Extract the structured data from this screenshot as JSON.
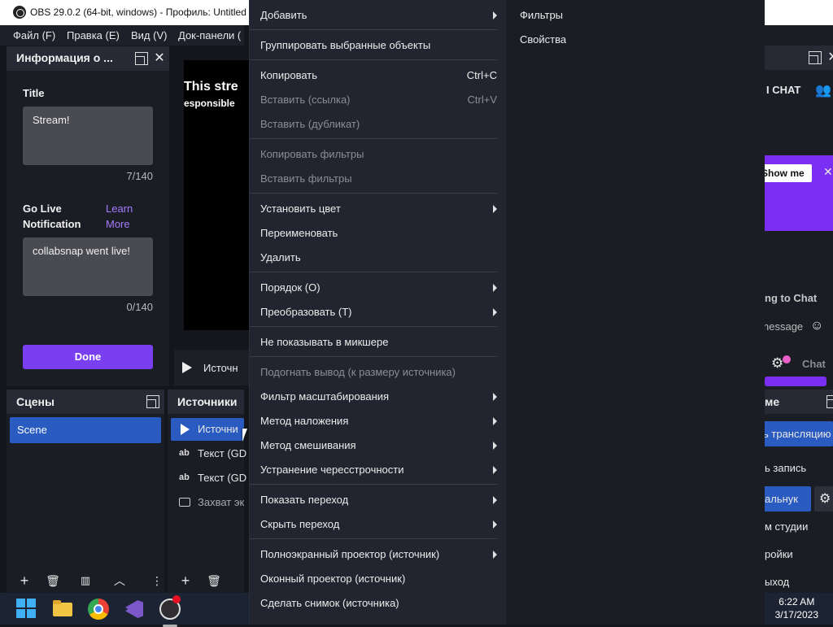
{
  "window": {
    "title": "OBS 29.0.2 (64-bit, windows) - Профиль: Untitled",
    "minimize_glyph": "—",
    "maximize_glyph": "☐",
    "close_glyph": "✕"
  },
  "menubar": [
    "Файл (F)",
    "Правка (E)",
    "Вид (V)",
    "Док-панели ("
  ],
  "info_dock": {
    "title": "Информация о ...",
    "title_label": "Title",
    "title_value": "Stream!",
    "title_count": "7/140",
    "notification_label_1": "Go Live",
    "notification_label_2": "Notification",
    "learn_more_1": "Learn",
    "learn_more_2": "More",
    "notification_value": "collabsnap went live!",
    "notification_count": "0/140",
    "done_label": "Done"
  },
  "preview": {
    "line1": "This stre",
    "line2": "esponsible"
  },
  "source_toolbar": {
    "name": "Источн"
  },
  "scenes": {
    "title": "Сцены",
    "items": [
      "Scene"
    ]
  },
  "sources": {
    "title": "Источники",
    "items": [
      {
        "icon": "play-icon",
        "name": "Источни"
      },
      {
        "icon": "text-icon",
        "name": "Текст (GD"
      },
      {
        "icon": "text-icon",
        "name": "Текст (GD"
      },
      {
        "icon": "monitor-icon",
        "name": "Захват эк"
      }
    ],
    "text_icon_glyph": "ab"
  },
  "context_menu": {
    "items": [
      {
        "label": "Добавить",
        "submenu": true,
        "disabled": false
      },
      {
        "sep": true
      },
      {
        "label": "Группировать выбранные объекты",
        "disabled": false
      },
      {
        "sep": true
      },
      {
        "label": "Копировать",
        "shortcut": "Ctrl+C",
        "disabled": false
      },
      {
        "label": "Вставить (ссылка)",
        "shortcut": "Ctrl+V",
        "disabled": true
      },
      {
        "label": "Вставить (дубликат)",
        "disabled": true
      },
      {
        "sep": true
      },
      {
        "label": "Копировать фильтры",
        "disabled": true
      },
      {
        "label": "Вставить фильтры",
        "disabled": true
      },
      {
        "sep": true
      },
      {
        "label": "Установить цвет",
        "submenu": true,
        "disabled": false
      },
      {
        "label": "Переименовать",
        "disabled": false
      },
      {
        "label": "Удалить",
        "disabled": false
      },
      {
        "sep": true
      },
      {
        "label": "Порядок (O)",
        "submenu": true,
        "disabled": false
      },
      {
        "label": "Преобразовать (T)",
        "submenu": true,
        "disabled": false
      },
      {
        "sep": true
      },
      {
        "label": "Не показывать в микшере",
        "disabled": false
      },
      {
        "sep": true
      },
      {
        "label": "Подогнать вывод (к размеру источника)",
        "disabled": true
      },
      {
        "label": "Фильтр масштабирования",
        "submenu": true,
        "disabled": false
      },
      {
        "label": "Метод наложения",
        "submenu": true,
        "disabled": false
      },
      {
        "label": "Метод смешивания",
        "submenu": true,
        "disabled": false
      },
      {
        "label": "Устранение чересстрочности",
        "submenu": true,
        "disabled": false
      },
      {
        "sep": true
      },
      {
        "label": "Показать переход",
        "submenu": true,
        "disabled": false
      },
      {
        "label": "Скрыть переход",
        "submenu": true,
        "disabled": false
      },
      {
        "sep": true
      },
      {
        "label": "Полноэкранный проектор (источник)",
        "submenu": true,
        "disabled": false
      },
      {
        "label": "Оконный проектор (источник)",
        "disabled": false
      },
      {
        "label": "Сделать снимок (источника)",
        "disabled": false
      }
    ]
  },
  "submenu": [
    "Фильтры",
    "Свойства"
  ],
  "right_panel": {
    "chat_label": "I CHAT",
    "show_me": "Show me",
    "ng_to_chat": "ng to Chat",
    "message": "nessage",
    "chat": "Chat",
    "me": "ме",
    "start_stream": "ь трансляцию",
    "start_record": "ь запись",
    "virtual_cam": "альнук",
    "studio_mode": "м студии",
    "settings": "ройки",
    "exit": "ыход"
  },
  "taskbar": {
    "time": "6:22 AM",
    "date": "3/17/2023"
  }
}
